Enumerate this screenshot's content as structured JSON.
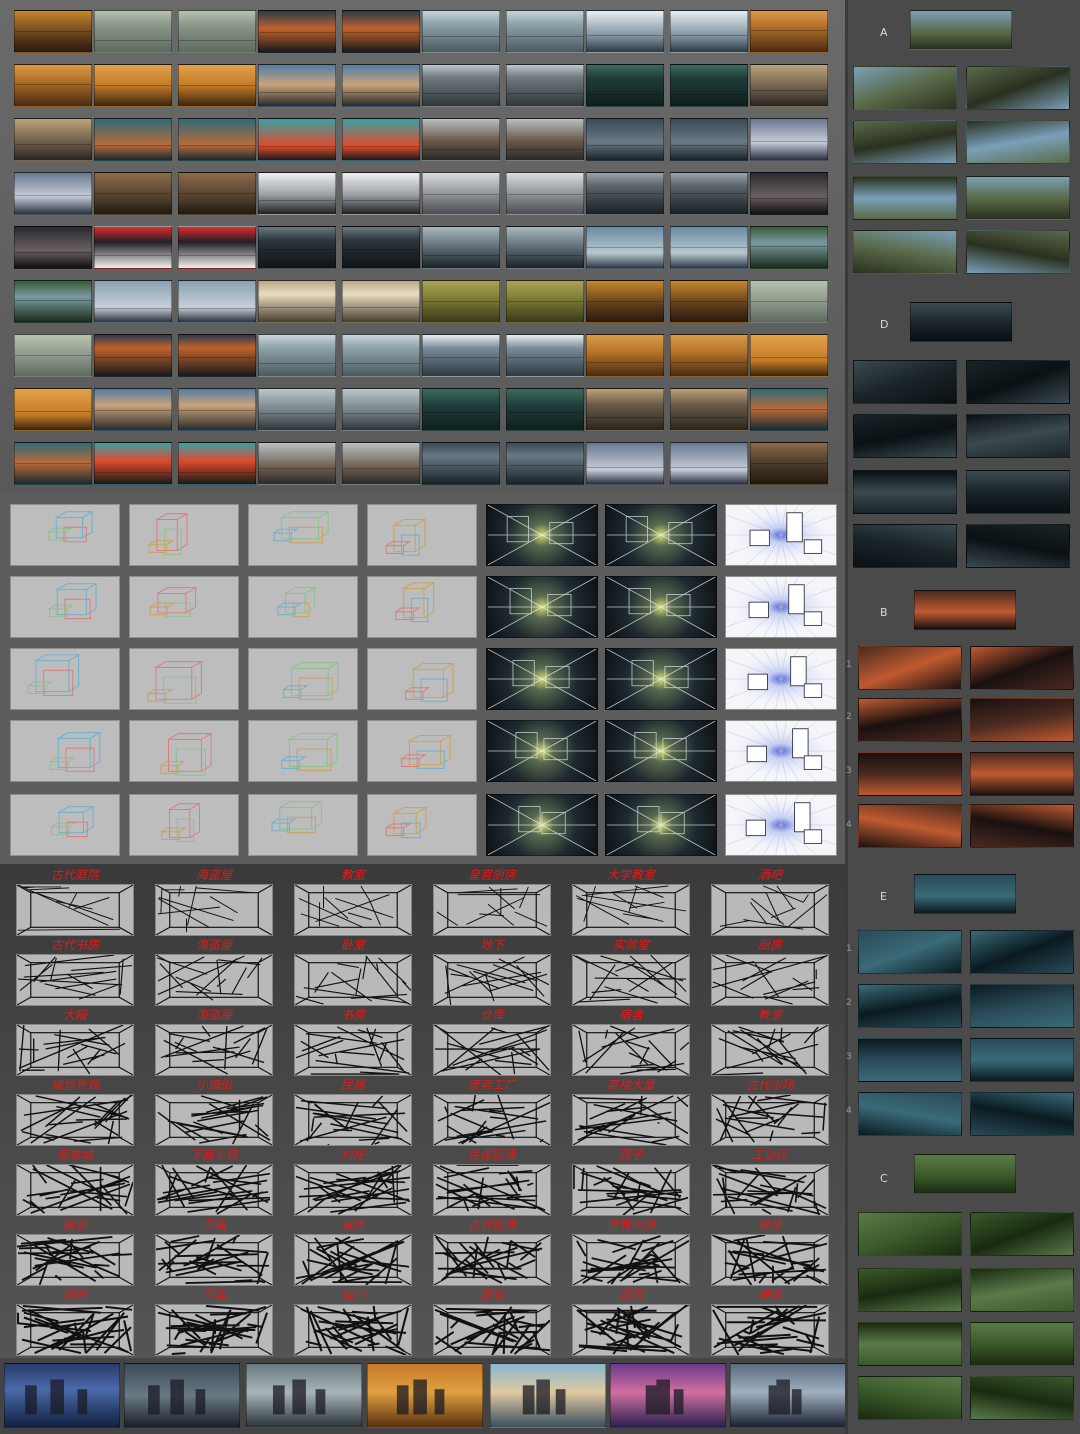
{
  "side_panels": [
    {
      "label": "A"
    },
    {
      "label": "D"
    },
    {
      "label": "B",
      "row_numbers": [
        "1",
        "2",
        "3",
        "4"
      ]
    },
    {
      "label": "E",
      "row_numbers": [
        "1",
        "2",
        "3",
        "4"
      ]
    },
    {
      "label": "C"
    }
  ],
  "sketch_captions": [
    [
      "古代庭院",
      "海盗屋",
      "教室",
      "皇宫厨房",
      "大学教室",
      "酒吧"
    ],
    [
      "古代书房",
      "海盗屋",
      "卧室",
      "地下",
      "实验室",
      "厨房"
    ],
    [
      "大殿",
      "海盗屋",
      "书房",
      "仓库",
      "宿舍",
      "教堂"
    ],
    [
      "城堡外观",
      "小镇街",
      "民居",
      "废弃工厂",
      "高楼大厦",
      "古代市场"
    ],
    [
      "废墟城",
      "下面小镇",
      "村庄",
      "民国街道",
      "院子",
      "工业区"
    ],
    [
      "国会",
      "寺庙",
      "城堡",
      "古代街道",
      "皇宫内部",
      "楼梯"
    ],
    [
      "胡同",
      "寺庙",
      "城门",
      "废墟",
      "建筑",
      "牌楼"
    ]
  ],
  "colors": {
    "page_bg": "#5a5a5a",
    "right_panel_bg": "#4a4a4a",
    "caption_red": "#e01b1b",
    "sketch_bg": "#b9b9b9",
    "box_bg": "#bdbdbd"
  }
}
